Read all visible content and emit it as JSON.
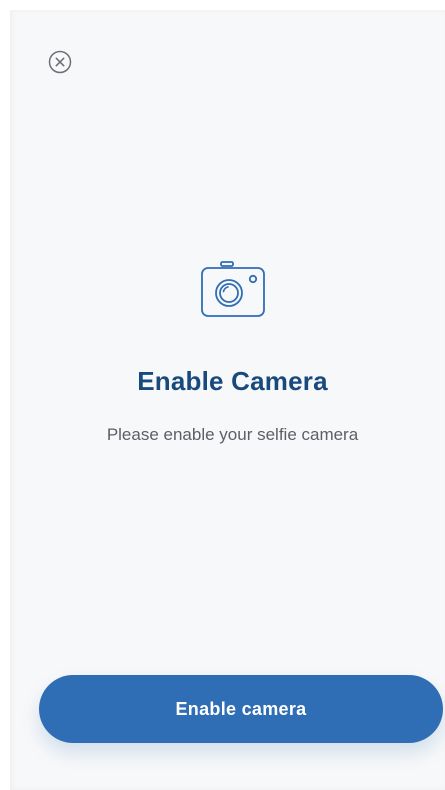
{
  "header": {
    "close_icon": "close-circle-icon"
  },
  "main": {
    "icon": "camera-icon",
    "title": "Enable Camera",
    "subtitle": "Please enable your selfie camera"
  },
  "footer": {
    "button_label": "Enable camera"
  },
  "colors": {
    "primary": "#2f6db5",
    "title": "#184a7e",
    "subtitle": "#5c5f66",
    "icon_stroke": "#2f6db5",
    "background": "#f7f8f9"
  }
}
